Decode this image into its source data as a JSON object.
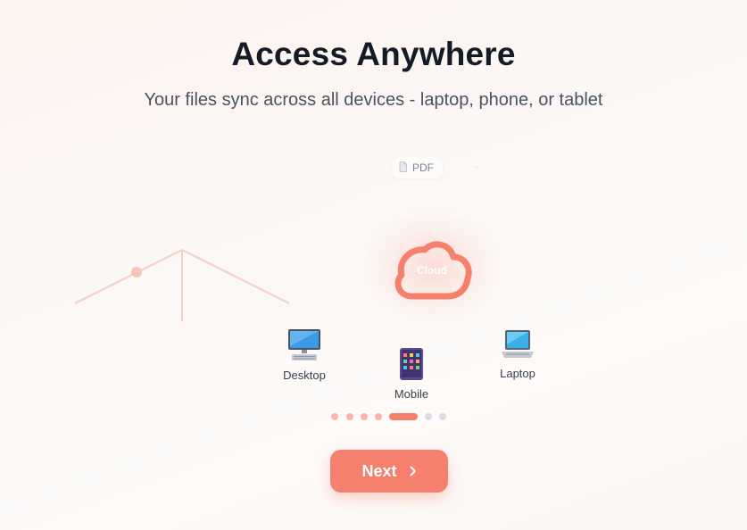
{
  "header": {
    "title": "Access Anywhere",
    "subtitle": "Your files sync across all devices - laptop, phone, or tablet"
  },
  "illustration": {
    "file_chip": {
      "icon": "document-icon",
      "label": "PDF"
    },
    "hub": {
      "icon": "cloud-icon",
      "label": "Cloud"
    },
    "devices": [
      {
        "icon": "desktop-computer-icon",
        "label": "Desktop"
      },
      {
        "icon": "tablet-icon",
        "label": "Mobile"
      },
      {
        "icon": "laptop-icon",
        "label": "Laptop"
      }
    ]
  },
  "pagination": {
    "total_steps": 7,
    "current_step": 5
  },
  "actions": {
    "next_label": "Next",
    "next_icon": "chevron-right-icon"
  },
  "colors": {
    "accent": "#f6806e",
    "dot_completed": "#f9b6ab",
    "dot_upcoming": "#d9dbe3",
    "title": "#141a26",
    "subtitle": "#4b5262"
  }
}
